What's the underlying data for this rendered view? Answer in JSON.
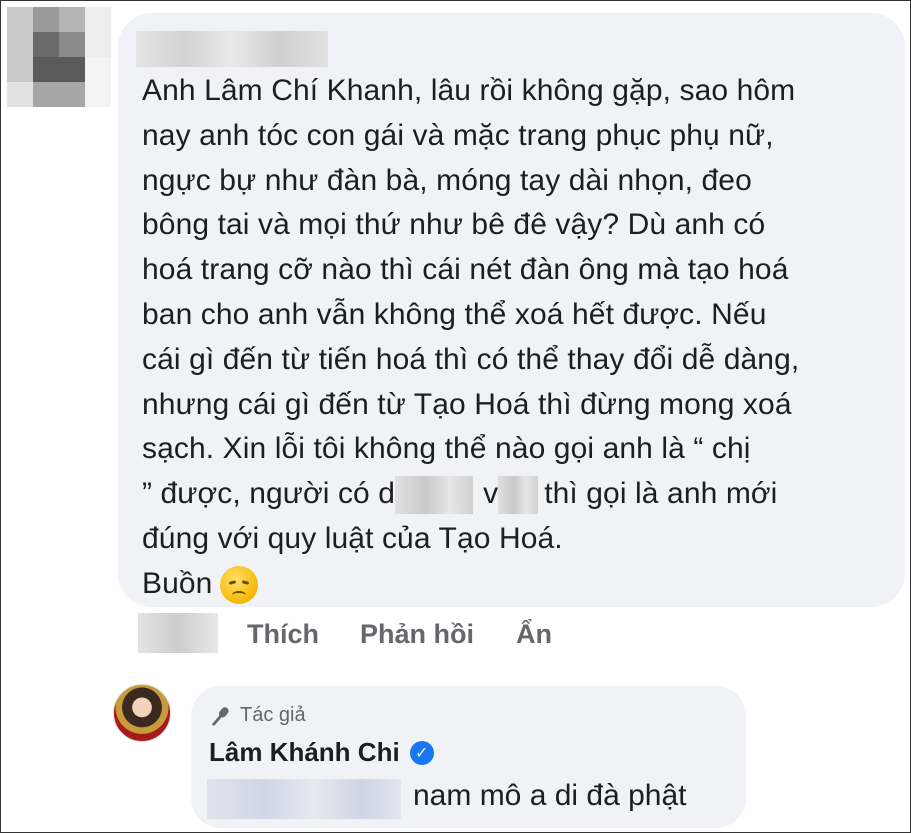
{
  "comment": {
    "lines": [
      "Anh Lâm Chí Khanh, lâu rồi không gặp, sao hôm",
      "nay anh tóc con gái và mặc trang phục phụ nữ,",
      "ngực bự như đàn bà, móng tay dài nhọn, đeo",
      "bông tai và mọi thứ như bê đê vậy? Dù anh có",
      "hoá trang cỡ nào thì cái nét đàn ông mà tạo hoá",
      "ban cho anh vẫn không thể xoá hết được. Nếu",
      "cái gì đến từ tiến hoá thì có thể thay đổi dễ dàng,",
      "nhưng cái gì đến từ Tạo Hoá thì đừng mong xoá",
      "sạch. Xin lỗi tôi không thể nào gọi anh là “ chị"
    ],
    "line10_a": "” được, người có d",
    "line10_b": "v",
    "line10_c": "thì gọi là anh mới",
    "line11": "đúng với quy luật của Tạo Hoá.",
    "line12": "Buồn",
    "emoji": "sad-face"
  },
  "actions": {
    "like": "Thích",
    "reply": "Phản hồi",
    "hide": "Ẩn"
  },
  "reply": {
    "badge": "Tác giả",
    "author": "Lâm Khánh Chi",
    "text": "nam mô a di đà phật"
  }
}
